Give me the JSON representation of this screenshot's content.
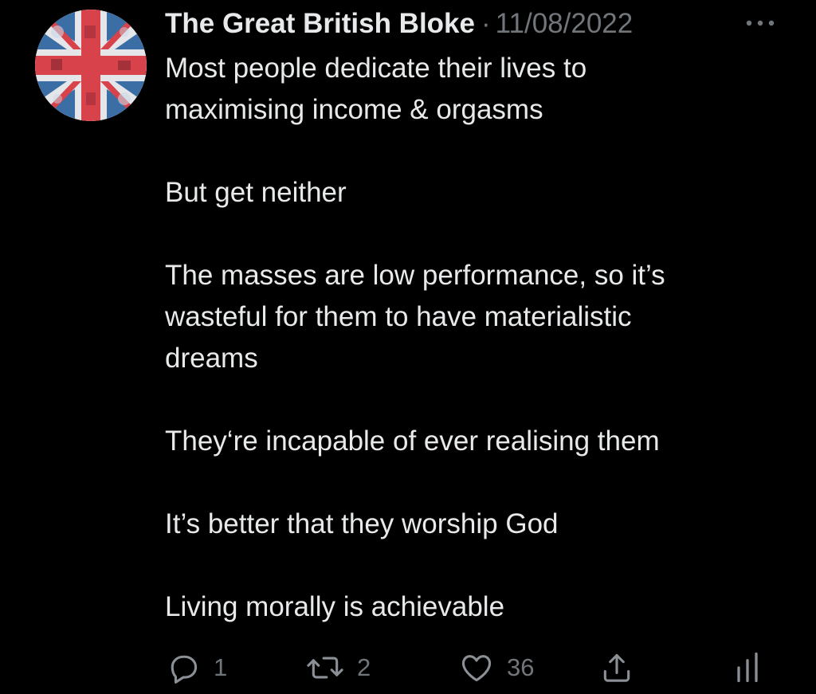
{
  "tweet": {
    "author_name": "The Great British Bloke",
    "separator": "·",
    "date": "11/08/2022",
    "paragraphs": [
      {
        "lines": [
          "Most people dedicate their lives to",
          "maximising income & orgasms"
        ]
      },
      {
        "lines": [
          "But get neither"
        ]
      },
      {
        "lines": [
          "The masses are low performance, so it’s",
          "wasteful for them to have materialistic",
          "dreams"
        ]
      },
      {
        "lines": [
          "They‘re incapable of ever realising them"
        ]
      },
      {
        "lines": [
          "It’s better that they worship God"
        ]
      },
      {
        "lines": [
          "Living morally is achievable"
        ]
      }
    ]
  },
  "actions": {
    "reply": {
      "icon": "reply-icon",
      "count": "1"
    },
    "retweet": {
      "icon": "retweet-icon",
      "count": "2"
    },
    "like": {
      "icon": "heart-icon",
      "count": "36"
    },
    "share": {
      "icon": "share-icon"
    },
    "analytics": {
      "icon": "analytics-icon"
    }
  },
  "colors": {
    "background": "#000000",
    "primary_text": "#e7e9ea",
    "secondary_text": "#71767b",
    "flag_blue": "#2a5a8f",
    "flag_red": "#d8424a"
  }
}
